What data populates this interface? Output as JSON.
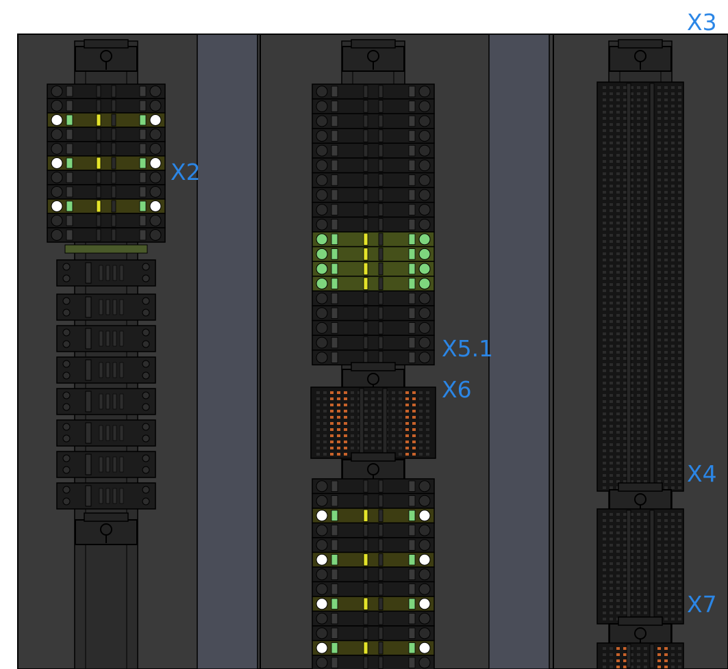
{
  "labels": {
    "x2": "X2",
    "x3": "X3",
    "x4": "X4",
    "x5_1": "X5.1",
    "x6": "X6",
    "x7": "X7"
  },
  "colors": {
    "cabinet_background": "#3a3a3a",
    "duct": "#4a4d58",
    "terminal_body": "#1a1a1a",
    "terminal_outline": "#000000",
    "highlight_yellow": "#e4e42a",
    "highlight_green": "#7ed67e",
    "marker_orange": "#c8622a",
    "label_blue": "#2b86e6"
  }
}
